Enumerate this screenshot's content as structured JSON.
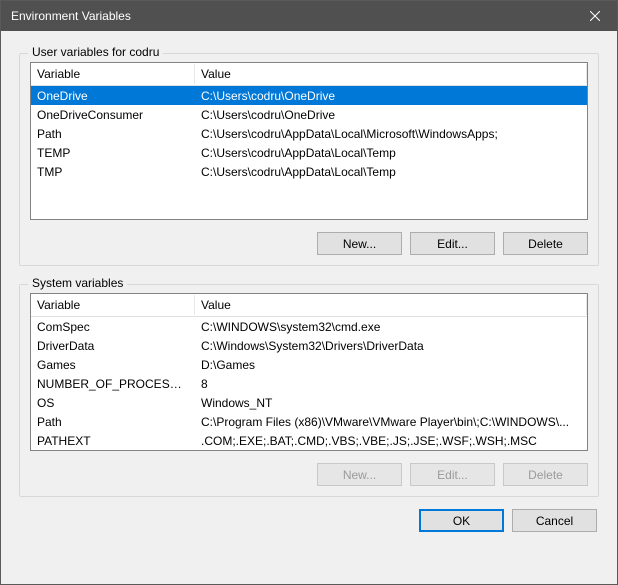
{
  "title": "Environment Variables",
  "user_section": {
    "label": "User variables for codru",
    "columns": {
      "variable": "Variable",
      "value": "Value"
    },
    "rows": [
      {
        "variable": "OneDrive",
        "value": "C:\\Users\\codru\\OneDrive",
        "selected": true
      },
      {
        "variable": "OneDriveConsumer",
        "value": "C:\\Users\\codru\\OneDrive"
      },
      {
        "variable": "Path",
        "value": "C:\\Users\\codru\\AppData\\Local\\Microsoft\\WindowsApps;"
      },
      {
        "variable": "TEMP",
        "value": "C:\\Users\\codru\\AppData\\Local\\Temp"
      },
      {
        "variable": "TMP",
        "value": "C:\\Users\\codru\\AppData\\Local\\Temp"
      }
    ],
    "buttons": {
      "new": "New...",
      "edit": "Edit...",
      "delete": "Delete"
    }
  },
  "system_section": {
    "label": "System variables",
    "columns": {
      "variable": "Variable",
      "value": "Value"
    },
    "rows": [
      {
        "variable": "ComSpec",
        "value": "C:\\WINDOWS\\system32\\cmd.exe"
      },
      {
        "variable": "DriverData",
        "value": "C:\\Windows\\System32\\Drivers\\DriverData"
      },
      {
        "variable": "Games",
        "value": "D:\\Games"
      },
      {
        "variable": "NUMBER_OF_PROCESSORS",
        "value": "8"
      },
      {
        "variable": "OS",
        "value": "Windows_NT"
      },
      {
        "variable": "Path",
        "value": "C:\\Program Files (x86)\\VMware\\VMware Player\\bin\\;C:\\WINDOWS\\..."
      },
      {
        "variable": "PATHEXT",
        "value": ".COM;.EXE;.BAT;.CMD;.VBS;.VBE;.JS;.JSE;.WSF;.WSH;.MSC"
      }
    ],
    "buttons": {
      "new": "New...",
      "edit": "Edit...",
      "delete": "Delete"
    },
    "buttons_disabled": true
  },
  "dialog_buttons": {
    "ok": "OK",
    "cancel": "Cancel"
  }
}
